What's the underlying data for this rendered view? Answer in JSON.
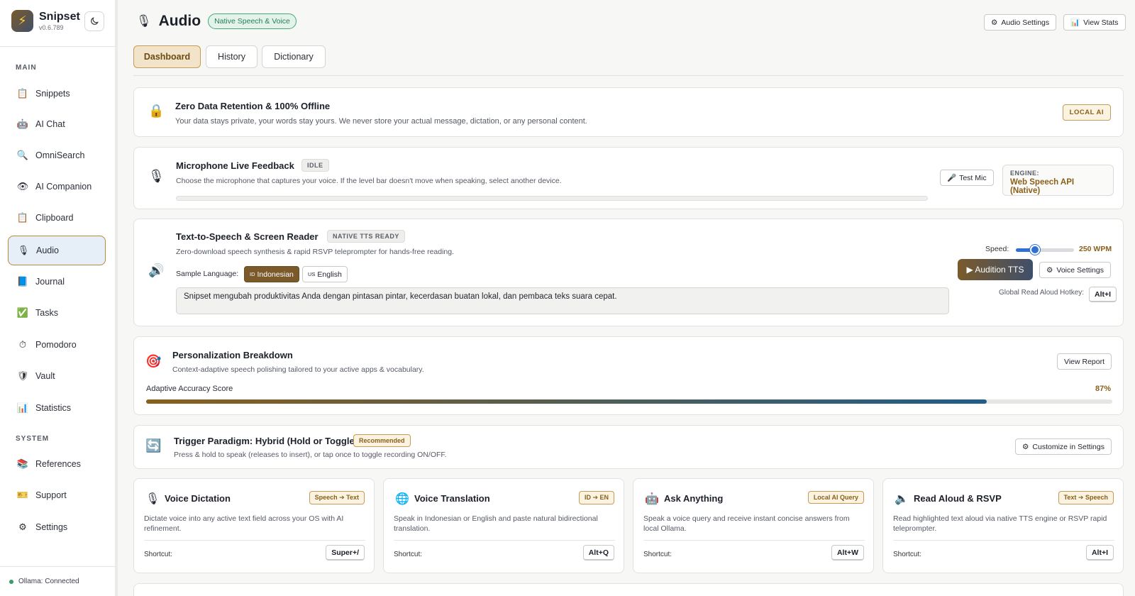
{
  "app": {
    "name": "Snipset",
    "version": "v0.6.789",
    "theme_icon": "moon-icon"
  },
  "sidebar": {
    "main_label": "MAIN",
    "system_label": "SYSTEM",
    "items": [
      {
        "label": "Snippets",
        "icon": "notepad-icon"
      },
      {
        "label": "AI Chat",
        "icon": "robot-icon"
      },
      {
        "label": "OmniSearch",
        "icon": "magnifier-icon"
      },
      {
        "label": "AI Companion",
        "icon": "eye-icon"
      },
      {
        "label": "Clipboard",
        "icon": "clipboard-icon"
      },
      {
        "label": "Audio",
        "icon": "microphone-icon",
        "active": true
      },
      {
        "label": "Journal",
        "icon": "book-icon"
      },
      {
        "label": "Tasks",
        "icon": "checkbox-icon"
      },
      {
        "label": "Pomodoro",
        "icon": "stopwatch-icon"
      },
      {
        "label": "Vault",
        "icon": "shield-icon"
      },
      {
        "label": "Statistics",
        "icon": "bar-chart-icon"
      }
    ],
    "system_items": [
      {
        "label": "References",
        "icon": "books-icon"
      },
      {
        "label": "Support",
        "icon": "ticket-icon"
      },
      {
        "label": "Settings",
        "icon": "gear-icon"
      }
    ],
    "status": "Ollama: Connected"
  },
  "header": {
    "title": "Audio",
    "badge": "Native Speech & Voice",
    "audio_settings": "Audio Settings",
    "view_stats": "View Stats"
  },
  "tabs": [
    "Dashboard",
    "History",
    "Dictionary"
  ],
  "privacy": {
    "title": "Zero Data Retention & 100% Offline",
    "subtitle": "Your data stays private, your words stay yours. We never store your actual message, dictation, or any personal content.",
    "badge": "LOCAL AI"
  },
  "mic": {
    "title": "Microphone Live Feedback",
    "status": "IDLE",
    "subtitle": "Choose the microphone that captures your voice. If the level bar doesn't move when speaking, select another device.",
    "level": 0,
    "test_button": "Test Mic",
    "engine_label": "ENGINE:",
    "engine_value": "Web Speech API (Native)"
  },
  "tts": {
    "title": "Text-to-Speech & Screen Reader",
    "badge": "NATIVE TTS READY",
    "subtitle": "Zero-download speech synthesis & rapid RSVP teleprompter for hands-free reading.",
    "sample_label": "Sample Language:",
    "lang_id_code": "ID",
    "lang_id": "Indonesian",
    "lang_en_code": "US",
    "lang_en": "English",
    "sample_text": "Snipset mengubah produktivitas Anda dengan pintasan pintar, kecerdasan buatan lokal, dan pembaca teks suara cepat.",
    "speed_label": "Speed:",
    "speed_value": "250 WPM",
    "speed_fraction": 0.33,
    "audition": "▶ Audition TTS",
    "voice_settings": "Voice Settings",
    "hotkey_label": "Global Read Aloud Hotkey:",
    "hotkey": "Alt+I"
  },
  "personalization": {
    "title": "Personalization Breakdown",
    "subtitle": "Context-adaptive speech polishing tailored to your active apps & vocabulary.",
    "view_report": "View Report",
    "accuracy_label": "Adaptive Accuracy Score",
    "accuracy_value": "87%",
    "accuracy_fraction": 0.87
  },
  "trigger": {
    "title": "Trigger Paradigm: Hybrid (Hold or Toggle)",
    "badge": "Recommended",
    "subtitle": "Press & hold to speak (releases to insert), or tap once to toggle recording ON/OFF.",
    "customize": "Customize in Settings"
  },
  "features": [
    {
      "title": "Voice Dictation",
      "badge": "Speech ➔ Text",
      "desc": "Dictate voice into any active text field across your OS with AI refinement.",
      "shortcut_label": "Shortcut:",
      "shortcut": "Super+/",
      "icon": "microphone-icon"
    },
    {
      "title": "Voice Translation",
      "badge": "ID ➔ EN",
      "desc": "Speak in Indonesian or English and paste natural bidirectional translation.",
      "shortcut_label": "Shortcut:",
      "shortcut": "Alt+Q",
      "icon": "globe-icon"
    },
    {
      "title": "Ask Anything",
      "badge": "Local AI Query",
      "desc": "Speak a voice query and receive instant concise answers from local Ollama.",
      "shortcut_label": "Shortcut:",
      "shortcut": "Alt+W",
      "icon": "robot-icon"
    },
    {
      "title": "Read Aloud & RSVP",
      "badge": "Text ➔ Speech",
      "desc": "Read highlighted text aloud via native TTS engine or RSVP rapid teleprompter.",
      "shortcut_label": "Shortcut:",
      "shortcut": "Alt+I",
      "icon": "speaker-icon"
    }
  ]
}
